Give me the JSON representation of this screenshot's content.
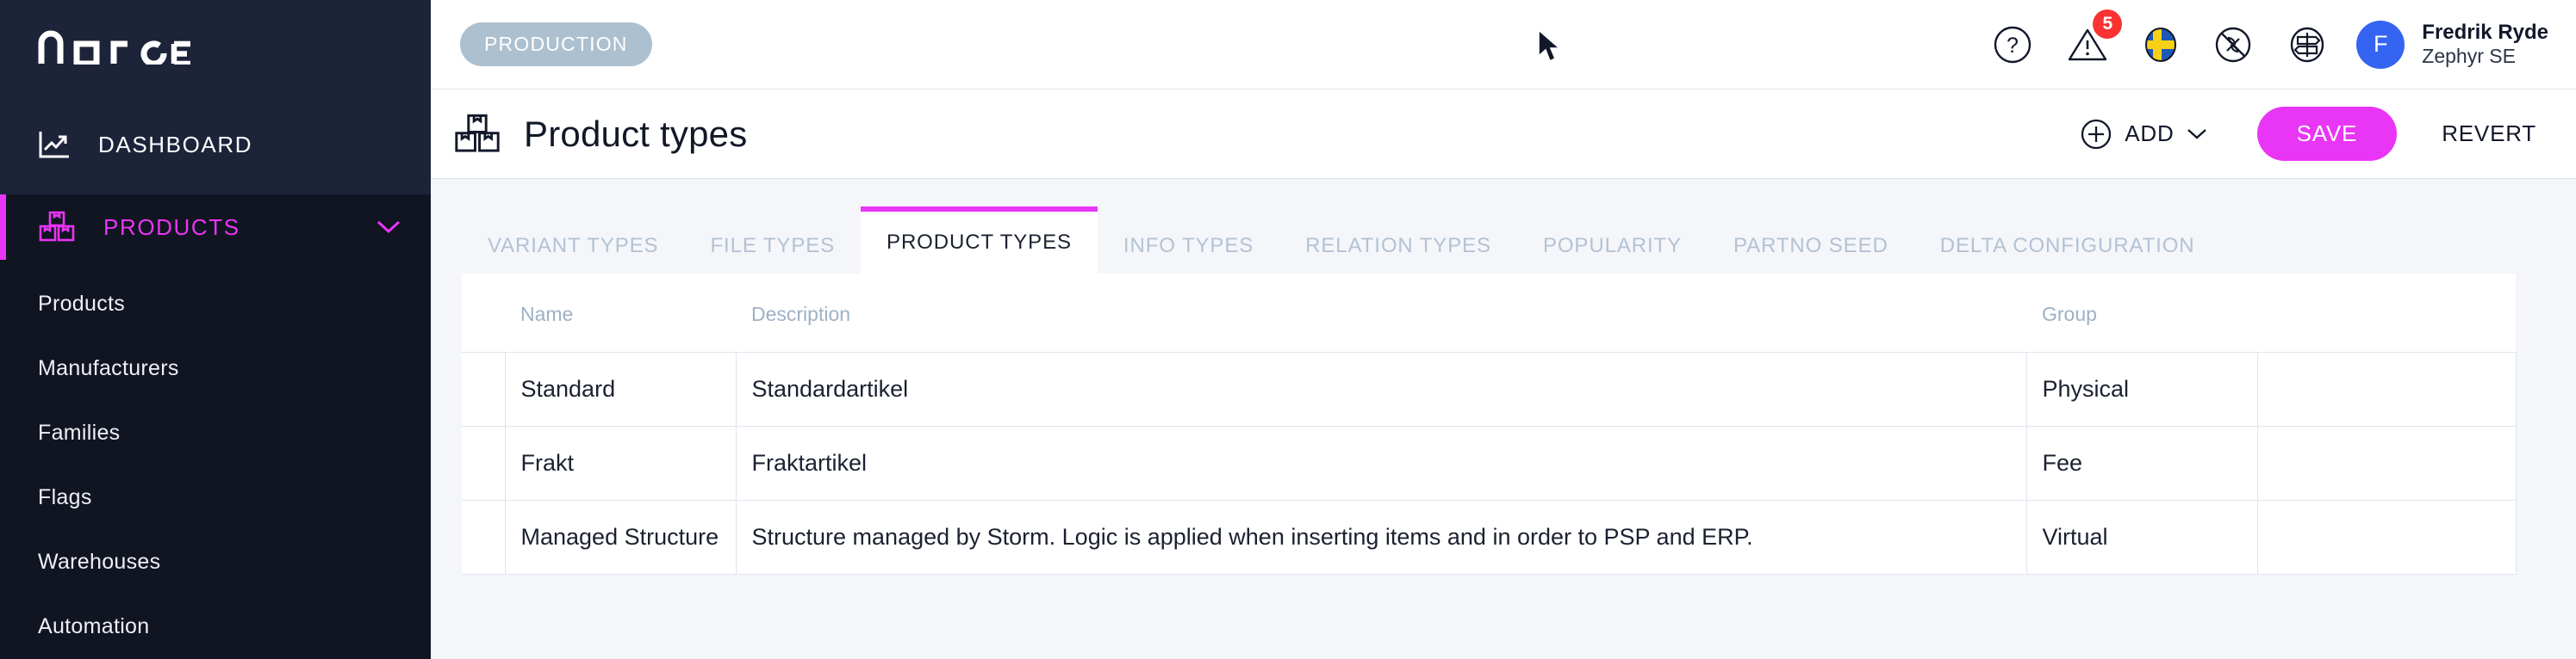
{
  "brand": {
    "logo_text": "norce"
  },
  "sidebar": {
    "dashboard": {
      "label": "DASHBOARD",
      "icon": "chart-line-icon"
    },
    "products": {
      "label": "PRODUCTS",
      "icon": "boxes-icon",
      "chevron": "chevron-down-icon"
    },
    "items": [
      {
        "label": "Products"
      },
      {
        "label": "Manufacturers"
      },
      {
        "label": "Families"
      },
      {
        "label": "Flags"
      },
      {
        "label": "Warehouses"
      },
      {
        "label": "Automation"
      }
    ]
  },
  "topbar": {
    "environment_badge": "PRODUCTION",
    "icons": [
      {
        "name": "help-icon",
        "glyph": "?"
      },
      {
        "name": "warning-icon",
        "badge": "5"
      },
      {
        "name": "flag-sweden-icon"
      },
      {
        "name": "no-edit-icon"
      },
      {
        "name": "signpost-icon"
      }
    ],
    "user": {
      "initial": "F",
      "name": "Fredrik Ryde",
      "org": "Zephyr SE"
    }
  },
  "pagehead": {
    "icon": "boxes-icon",
    "title": "Product types",
    "add_label": "ADD",
    "add_chevron": "chevron-down-icon",
    "save_label": "SAVE",
    "revert_label": "REVERT",
    "accent_color": "#e935f5"
  },
  "tabs": [
    {
      "label": "VARIANT TYPES",
      "active": false
    },
    {
      "label": "FILE TYPES",
      "active": false
    },
    {
      "label": "PRODUCT TYPES",
      "active": true
    },
    {
      "label": "INFO TYPES",
      "active": false
    },
    {
      "label": "RELATION TYPES",
      "active": false
    },
    {
      "label": "POPULARITY",
      "active": false
    },
    {
      "label": "PARTNO SEED",
      "active": false
    },
    {
      "label": "DELTA CONFIGURATION",
      "active": false
    }
  ],
  "table": {
    "columns": [
      {
        "key": "handle",
        "label": ""
      },
      {
        "key": "name",
        "label": "Name"
      },
      {
        "key": "description",
        "label": "Description"
      },
      {
        "key": "group",
        "label": "Group"
      },
      {
        "key": "end",
        "label": ""
      }
    ],
    "rows": [
      {
        "name": "Standard",
        "description": "Standardartikel",
        "group": "Physical"
      },
      {
        "name": "Frakt",
        "description": "Fraktartikel",
        "group": "Fee"
      },
      {
        "name": "Managed Structure",
        "description": "Structure managed by Storm. Logic is applied when inserting items and in order to PSP and ERP.",
        "group": "Virtual"
      }
    ]
  }
}
